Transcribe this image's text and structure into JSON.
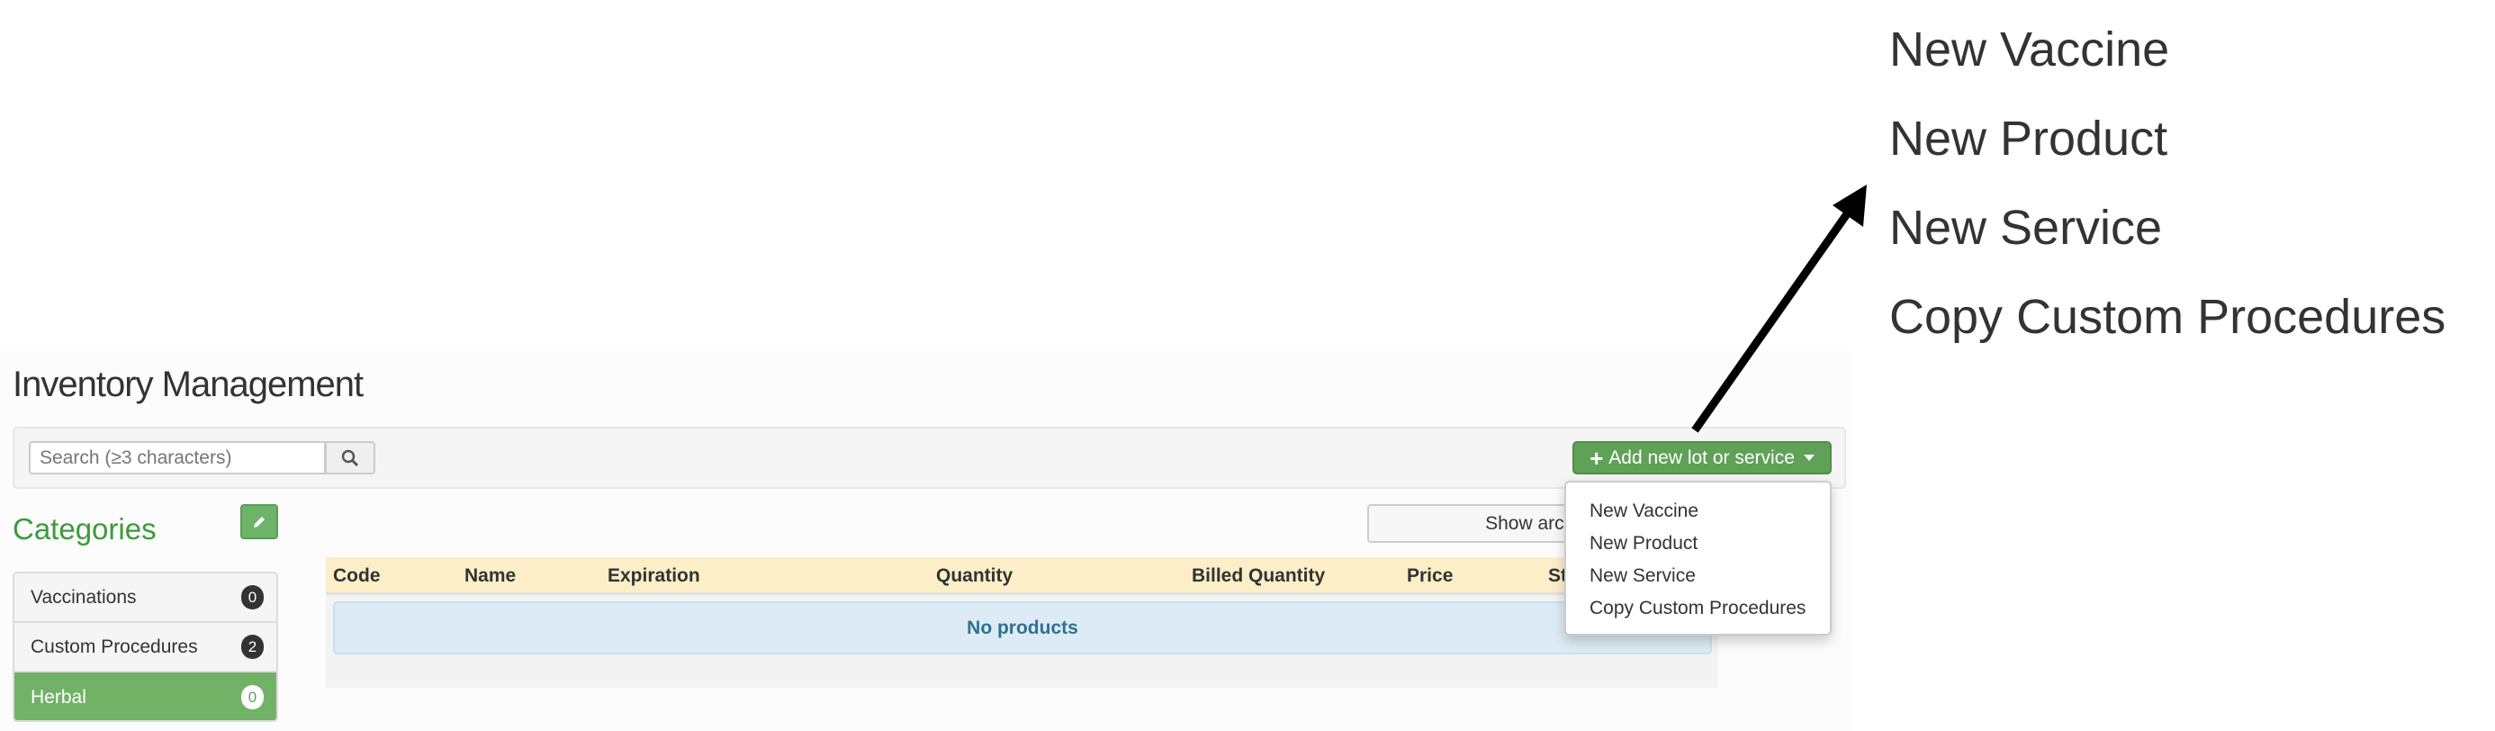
{
  "page": {
    "title": "Inventory Management"
  },
  "toolbar": {
    "search_placeholder": "Search (≥3 characters)",
    "search_icon": "magnifier-icon",
    "add_button_label": "Add new lot or service",
    "add_icon": "plus-icon"
  },
  "dropdown": {
    "items": [
      {
        "label": "New Vaccine"
      },
      {
        "label": "New Product"
      },
      {
        "label": "New Service"
      },
      {
        "label": "Copy Custom Procedures"
      }
    ]
  },
  "categories": {
    "title": "Categories",
    "edit_icon": "pencil-icon",
    "items": [
      {
        "label": "Vaccinations",
        "count": "0",
        "active": false
      },
      {
        "label": "Custom Procedures",
        "count": "2",
        "active": false
      },
      {
        "label": "Herbal",
        "count": "0",
        "active": true
      }
    ]
  },
  "archived_button_label": "Show archived",
  "table": {
    "columns": [
      "Code",
      "Name",
      "Expiration",
      "Quantity",
      "Billed Quantity",
      "Price",
      "Status"
    ],
    "empty_message": "No products"
  },
  "annotation": {
    "items": [
      "New Vaccine",
      "New Product",
      "New Service",
      "Copy Custom Procedures"
    ]
  },
  "colors": {
    "accent": "#5fa157",
    "category_title": "#3c9a3c",
    "empty_text": "#31708f",
    "table_header": "#fcefc8"
  }
}
